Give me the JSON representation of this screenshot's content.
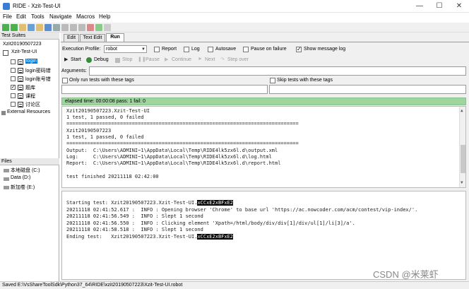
{
  "window": {
    "title": "RIDE - Xzit-Test-UI"
  },
  "menu": [
    "File",
    "Edit",
    "Tools",
    "Navigate",
    "Macros",
    "Help"
  ],
  "left": {
    "test_suites_title": "Test Suites",
    "root": "Xzit20190507223",
    "suite": "Xzit-Test-UI",
    "tests": [
      {
        "label": "login",
        "checked": false,
        "selected": true
      },
      {
        "label": "login密码错",
        "checked": false,
        "selected": false
      },
      {
        "label": "login账号错",
        "checked": false,
        "selected": false
      },
      {
        "label": "题库",
        "checked": true,
        "selected": false
      },
      {
        "label": "课程",
        "checked": false,
        "selected": false
      },
      {
        "label": "讨论区",
        "checked": false,
        "selected": false
      }
    ],
    "external": "External Resources",
    "files_title": "Files",
    "drives": [
      "本地磁盘 (C:)",
      "Data (D:)",
      "新加卷 (E:)"
    ]
  },
  "tabs": [
    "Edit",
    "Text Edit",
    "Run"
  ],
  "run": {
    "exec_profiler_label": "Execution Profile:",
    "profile_value": "robot",
    "report_label": "Report",
    "log_label": "Log",
    "autosave_label": "Autosave",
    "pause_on_failure_label": "Pause on failure",
    "show_message_log_label": "Show message log",
    "buttons": [
      "Start",
      "Debug",
      "Stop",
      "Pause",
      "Continue",
      "Next",
      "Step over"
    ],
    "arguments_label": "Arguments:",
    "only_run_label": "Only run tests with these tags",
    "skip_label": "Skip tests with these tags",
    "status": "elapsed time: 00:00:08     pass: 1     fail: 0"
  },
  "output_lines": [
    "Xzit20190507223.Xzit-Test-UI",
    "1 test, 1 passed, 0 failed",
    "==============================================================================",
    "Xzit20190507223",
    "1 test, 1 passed, 0 failed",
    "==============================================================================",
    "Output:  C:\\Users\\ADMINI~1\\AppData\\Local\\Temp\\RIDE4lk5zx6l.d\\output.xml",
    "Log:     C:\\Users\\ADMINI~1\\AppData\\Local\\Temp\\RIDE4lk5zx6l.d\\log.html",
    "Report:  C:\\Users\\ADMINI~1\\AppData\\Local\\Temp\\RIDE4lk5zx6l.d\\report.html",
    "",
    "test finished 20211118 02:42:00"
  ],
  "message_log": {
    "start_prefix": "Starting test: Xzit20190507223.Xzit-Test-UI.",
    "start_hl": "xCCxE2xBFxE2",
    "lines": [
      "20211118 02:41:52.617 :  INFO : Opening browser 'Chrome' to base url 'https://ac.nowcoder.com/acm/contest/vip-index/'.",
      "20211118 02:41:56.549 :  INFO : Slept 1 second",
      "20211118 02:41:56.550 :  INFO : Clicking element 'Xpath=/html/body/div/div[1]/div/ul[1]/li[3]/a'.",
      "20211118 02:41:58.518 :  INFO : Slept 1 second"
    ],
    "end_prefix": "Ending test:   Xzit20190507223.Xzit-Test-UI.",
    "end_hl": "xCCxE2xBFxE2"
  },
  "statusbar": "Saved E:\\VsShareToolSdk\\Python37_64\\RIDE\\xzit20190507223\\Xzit-Test-UI.robot",
  "watermark": "CSDN @米莱虾"
}
